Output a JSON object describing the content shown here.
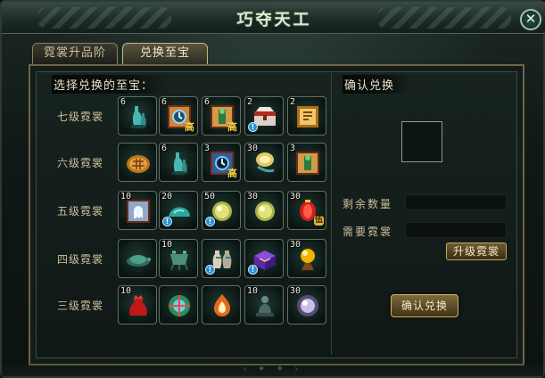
{
  "window": {
    "title": "巧夺天工",
    "close_icon": "close-icon"
  },
  "tabs": [
    {
      "label": "霓裳升品阶",
      "active": false
    },
    {
      "label": "兑换至宝",
      "active": true
    }
  ],
  "select_panel": {
    "title": "选择兑换的至宝：",
    "rows": [
      {
        "label": "七级霓裳",
        "items": [
          {
            "count": "6",
            "icon": "jade-vase-icon",
            "tag": "",
            "alert": false
          },
          {
            "count": "6",
            "icon": "clock-scroll-icon",
            "tag": "高",
            "alert": false
          },
          {
            "count": "6",
            "icon": "green-figure-scroll-icon",
            "tag": "高",
            "alert": false
          },
          {
            "count": "2",
            "icon": "treasure-chest-icon",
            "tag": "",
            "alert": true
          },
          {
            "count": "2",
            "icon": "golden-scroll-icon",
            "tag": "",
            "alert": false
          }
        ]
      },
      {
        "label": "六级霓裳",
        "items": [
          {
            "count": "",
            "icon": "turtle-shell-icon",
            "tag": "",
            "alert": false
          },
          {
            "count": "6",
            "icon": "jade-vase-icon",
            "tag": "",
            "alert": false
          },
          {
            "count": "3",
            "icon": "blue-clock-scroll-icon",
            "tag": "高",
            "alert": false
          },
          {
            "count": "30",
            "icon": "golden-leaf-icon",
            "tag": "",
            "alert": false
          },
          {
            "count": "3",
            "icon": "green-figure-scroll-icon",
            "tag": "",
            "alert": false
          }
        ]
      },
      {
        "label": "五级霓裳",
        "items": [
          {
            "count": "10",
            "icon": "ghost-scroll-icon",
            "tag": "",
            "alert": false
          },
          {
            "count": "20",
            "icon": "jade-stone-icon",
            "tag": "",
            "alert": true
          },
          {
            "count": "50",
            "icon": "golden-orb-icon",
            "tag": "",
            "alert": true
          },
          {
            "count": "30",
            "icon": "golden-orb-icon",
            "tag": "",
            "alert": false
          },
          {
            "count": "30",
            "icon": "red-lantern-icon",
            "tag": "伍",
            "alert": false
          }
        ]
      },
      {
        "label": "四级霓裳",
        "items": [
          {
            "count": "",
            "icon": "bronze-turtle-icon",
            "tag": "",
            "alert": false
          },
          {
            "count": "10",
            "icon": "bronze-cauldron-icon",
            "tag": "",
            "alert": false
          },
          {
            "count": "",
            "icon": "twin-vases-icon",
            "tag": "",
            "alert": true
          },
          {
            "count": "",
            "icon": "purple-chest-icon",
            "tag": "",
            "alert": true
          },
          {
            "count": "30",
            "icon": "crystal-ball-stand-icon",
            "tag": "",
            "alert": false
          }
        ]
      },
      {
        "label": "三级霓裳",
        "items": [
          {
            "count": "10",
            "icon": "red-pouch-icon",
            "tag": "",
            "alert": false
          },
          {
            "count": "",
            "icon": "magic-globe-icon",
            "tag": "",
            "alert": false
          },
          {
            "count": "",
            "icon": "fire-crystal-icon",
            "tag": "",
            "alert": false
          },
          {
            "count": "10",
            "icon": "buddha-statue-icon",
            "tag": "",
            "alert": false
          },
          {
            "count": "30",
            "icon": "mystic-orb-icon",
            "tag": "",
            "alert": false
          }
        ]
      }
    ]
  },
  "confirm_panel": {
    "title": "确认兑换",
    "remaining_label": "剩余数量",
    "remaining_value": "",
    "required_label": "需要霓裳",
    "required_value": "",
    "upgrade_button": "升级霓裳",
    "confirm_button": "确认兑换"
  }
}
